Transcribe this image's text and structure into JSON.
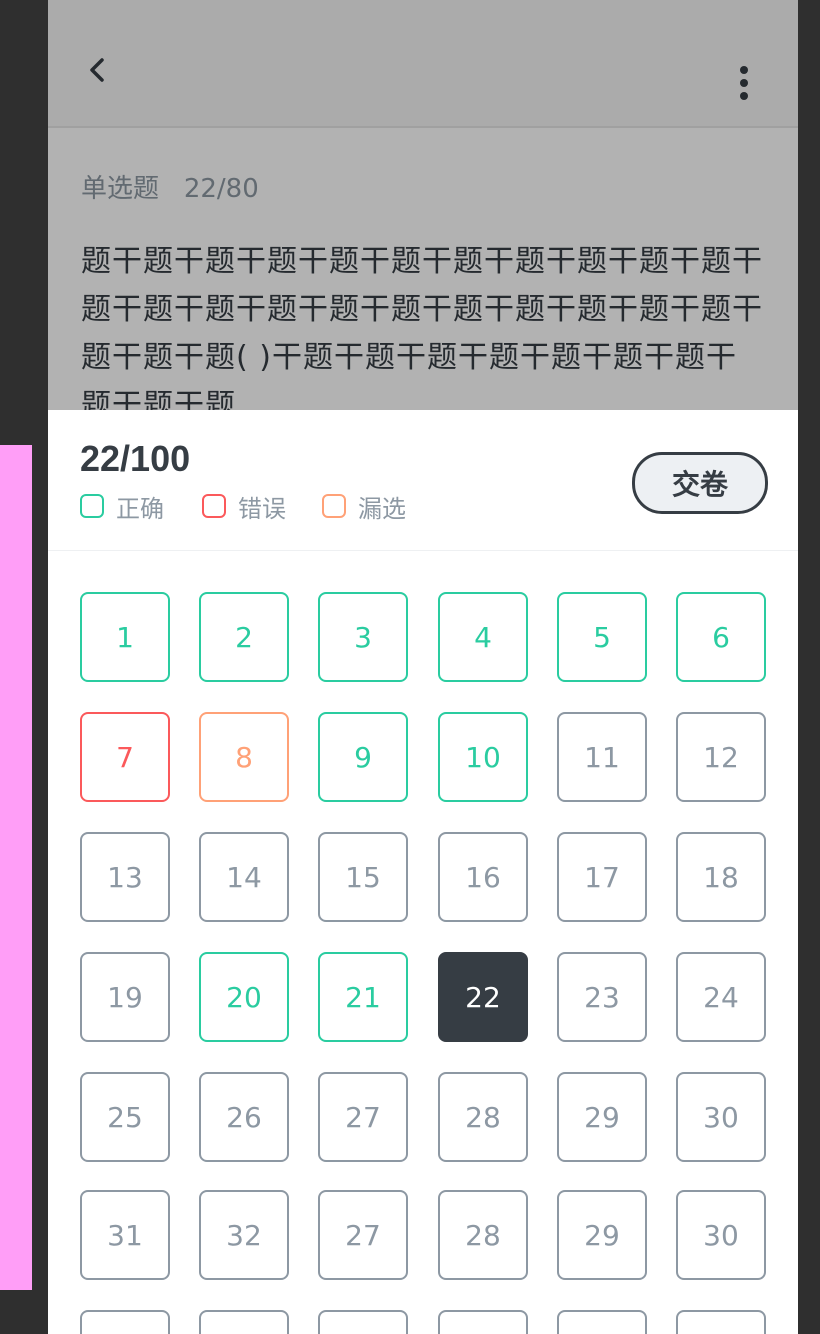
{
  "header": {
    "back_icon": "chevron-left-icon",
    "more_icon": "more-vertical-icon"
  },
  "question": {
    "type_label": "单选题",
    "index_text": "22/80",
    "text": "题干题干题干题干题干题干题干题干题干题干题干题干题干题干题干题干题干题干题干题干题干题干题干题干题(      )干题干题干题干题干题干题干题干题干题干题"
  },
  "answer_sheet": {
    "progress": "22/100",
    "submit_label": "交卷",
    "legend": [
      {
        "label": "正确",
        "color": "#2acca0"
      },
      {
        "label": "错误",
        "color": "#fb595b"
      },
      {
        "label": "漏选",
        "color": "#ffa177"
      }
    ],
    "colors": {
      "text_primary": "#363d44",
      "text_secondary": "#8d98a3",
      "correct": "#2acca0",
      "wrong": "#fb595b",
      "missed": "#ffa177",
      "current_fill": "#363d44",
      "submit_fill": "#edf0f3"
    },
    "cells": [
      {
        "n": "1",
        "state": "correct"
      },
      {
        "n": "2",
        "state": "correct"
      },
      {
        "n": "3",
        "state": "correct"
      },
      {
        "n": "4",
        "state": "correct"
      },
      {
        "n": "5",
        "state": "correct"
      },
      {
        "n": "6",
        "state": "correct"
      },
      {
        "n": "7",
        "state": "wrong"
      },
      {
        "n": "8",
        "state": "missed"
      },
      {
        "n": "9",
        "state": "correct"
      },
      {
        "n": "10",
        "state": "correct"
      },
      {
        "n": "11",
        "state": "default"
      },
      {
        "n": "12",
        "state": "default"
      },
      {
        "n": "13",
        "state": "default"
      },
      {
        "n": "14",
        "state": "default"
      },
      {
        "n": "15",
        "state": "default"
      },
      {
        "n": "16",
        "state": "default"
      },
      {
        "n": "17",
        "state": "default"
      },
      {
        "n": "18",
        "state": "default"
      },
      {
        "n": "19",
        "state": "default"
      },
      {
        "n": "20",
        "state": "correct"
      },
      {
        "n": "21",
        "state": "correct"
      },
      {
        "n": "22",
        "state": "current"
      },
      {
        "n": "23",
        "state": "default"
      },
      {
        "n": "24",
        "state": "default"
      },
      {
        "n": "25",
        "state": "default"
      },
      {
        "n": "26",
        "state": "default"
      },
      {
        "n": "27",
        "state": "default"
      },
      {
        "n": "28",
        "state": "default"
      },
      {
        "n": "29",
        "state": "default"
      },
      {
        "n": "30",
        "state": "default"
      },
      {
        "n": "31",
        "state": "default"
      },
      {
        "n": "32",
        "state": "default"
      },
      {
        "n": "27",
        "state": "default"
      },
      {
        "n": "28",
        "state": "default"
      },
      {
        "n": "29",
        "state": "default"
      },
      {
        "n": "30",
        "state": "default"
      },
      {
        "n": "",
        "state": "default"
      },
      {
        "n": "",
        "state": "default"
      },
      {
        "n": "",
        "state": "default"
      },
      {
        "n": "",
        "state": "default"
      },
      {
        "n": "",
        "state": "default"
      },
      {
        "n": "",
        "state": "default"
      }
    ]
  }
}
